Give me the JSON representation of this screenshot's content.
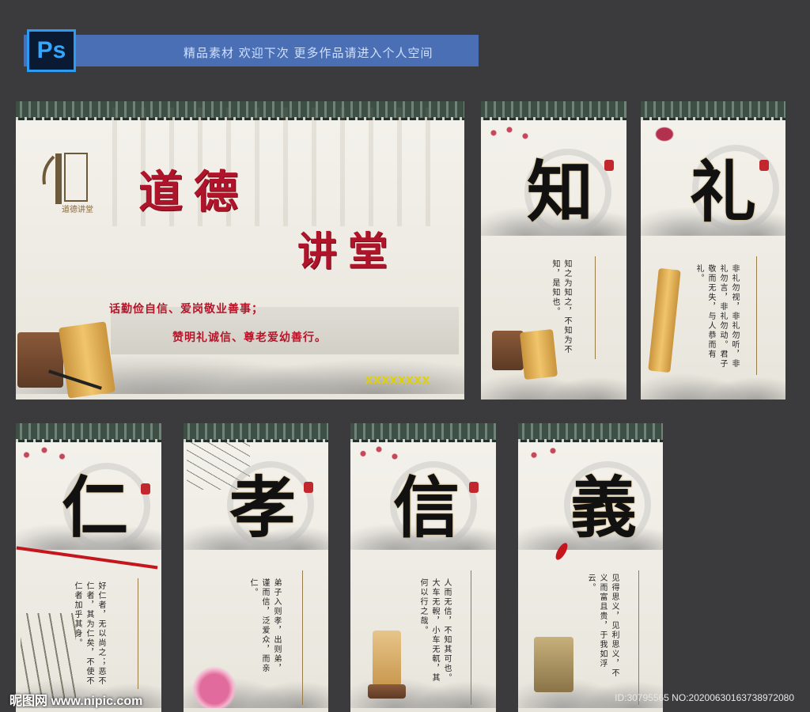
{
  "banner": {
    "app_icon_label": "Ps",
    "text": "精品素材 欢迎下次 更多作品请进入个人空间"
  },
  "main_panel": {
    "title_line1": "道德",
    "title_line2": "讲堂",
    "slogan_line1": "话勤俭自信、爱岗敬业善事；",
    "slogan_line2": "赞明礼诚信、尊老爱幼善行。",
    "logo_text": "道德讲堂",
    "placeholder": "XXXXXXXX"
  },
  "panels": [
    {
      "char": "知",
      "text": "知之为知之，不知为不知，是知也。"
    },
    {
      "char": "礼",
      "text": "非礼勿视，非礼勿听，非礼勿言，非礼勿动。君子敬而无失，与人恭而有礼。"
    },
    {
      "char": "仁",
      "text": "好仁者，无以尚之；恶不仁者，其为仁矣，不使不仁者加乎其身。"
    },
    {
      "char": "孝",
      "text": "弟子入则孝，出则弟，谨而信，泛爱众，而亲仁。"
    },
    {
      "char": "信",
      "text": "人而无信，不知其可也。大车无輗，小车无軏，其何以行之哉。"
    },
    {
      "char": "義",
      "text": "见得思义，见利思义，不义而富且贵，于我如浮云。"
    }
  ],
  "watermark": {
    "left": "昵图网 www.nipic.com",
    "right": "ID:30795565 NO:20200630163738972080"
  },
  "colors": {
    "background": "#3b3b3d",
    "banner": "#4a6fb5",
    "title_red": "#b0142a",
    "roof": "#3e4f46"
  }
}
